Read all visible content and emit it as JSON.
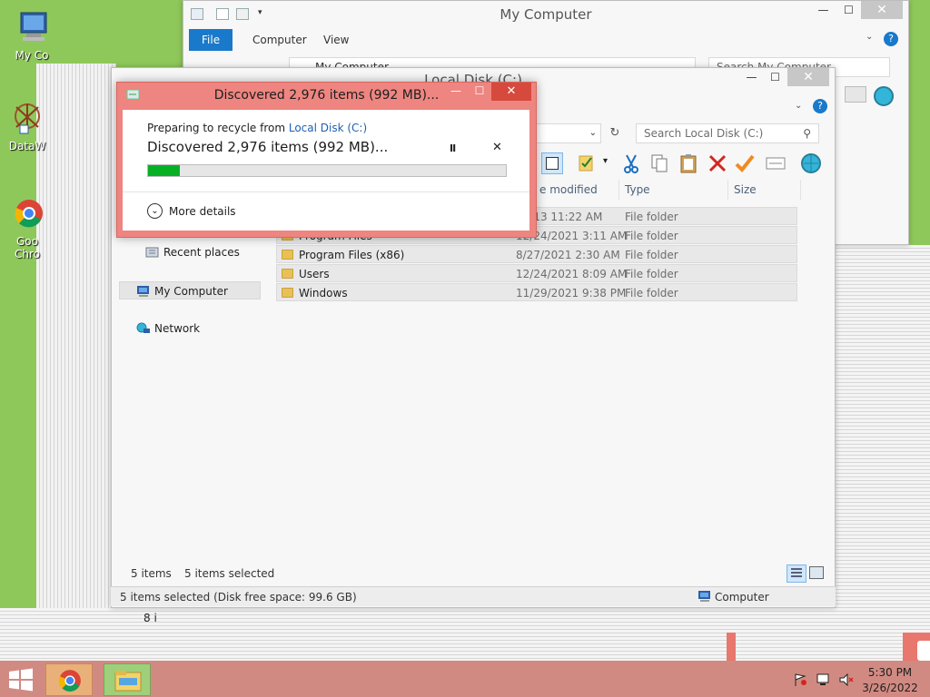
{
  "desktop": {
    "icons": [
      {
        "label": "My Co",
        "icon": "my-computer-icon"
      },
      {
        "label": "DataW",
        "icon": "datawatch-icon"
      },
      {
        "label": "Goo",
        "label2": "Chro",
        "icon": "chrome-icon"
      }
    ],
    "background_text": "8 i"
  },
  "my_computer_window": {
    "title": "My Computer",
    "ribbon_tabs": [
      "File",
      "Computer",
      "View"
    ],
    "address": "My Computer",
    "search_placeholder": "Search My Computer"
  },
  "local_disk_window": {
    "title": "Local Disk (C:)",
    "search_placeholder": "Search Local Disk (C:)",
    "columns": [
      "e modified",
      "Type",
      "Size"
    ],
    "nav": {
      "recent_places": "Recent places",
      "my_computer": "My Computer",
      "network": "Network"
    },
    "rows": [
      {
        "name": "",
        "date": "/2013 11:22 AM",
        "type": "File folder"
      },
      {
        "name": "Program Files",
        "date": "12/24/2021 3:11 AM",
        "type": "File folder"
      },
      {
        "name": "Program Files (x86)",
        "date": "8/27/2021 2:30 AM",
        "type": "File folder"
      },
      {
        "name": "Users",
        "date": "12/24/2021 8:09 AM",
        "type": "File folder"
      },
      {
        "name": "Windows",
        "date": "11/29/2021 9:38 PM",
        "type": "File folder"
      }
    ],
    "footer": {
      "items_count": "5 items",
      "items_selected": "5 items selected"
    },
    "status": {
      "text": "5 items selected (Disk free space: 99.6 GB)",
      "location": "Computer"
    }
  },
  "progress_dialog": {
    "title": "Discovered 2,976 items (992 MB)...",
    "subtitle_prefix": "Preparing to recycle from ",
    "subtitle_link": "Local Disk (C:)",
    "headline": "Discovered 2,976 items (992 MB)...",
    "progress_fraction": 0.09,
    "more_details": "More details",
    "pause_glyph": "II",
    "cancel_glyph": "✕"
  },
  "taskbar": {
    "time": "5:30 PM",
    "date": "3/26/2022"
  },
  "colors": {
    "dialog_frame": "#ee8580",
    "progress": "#06b025",
    "ribbon_file": "#1979ca",
    "taskbar": "#d18a82",
    "desktop": "#8fc85a"
  }
}
